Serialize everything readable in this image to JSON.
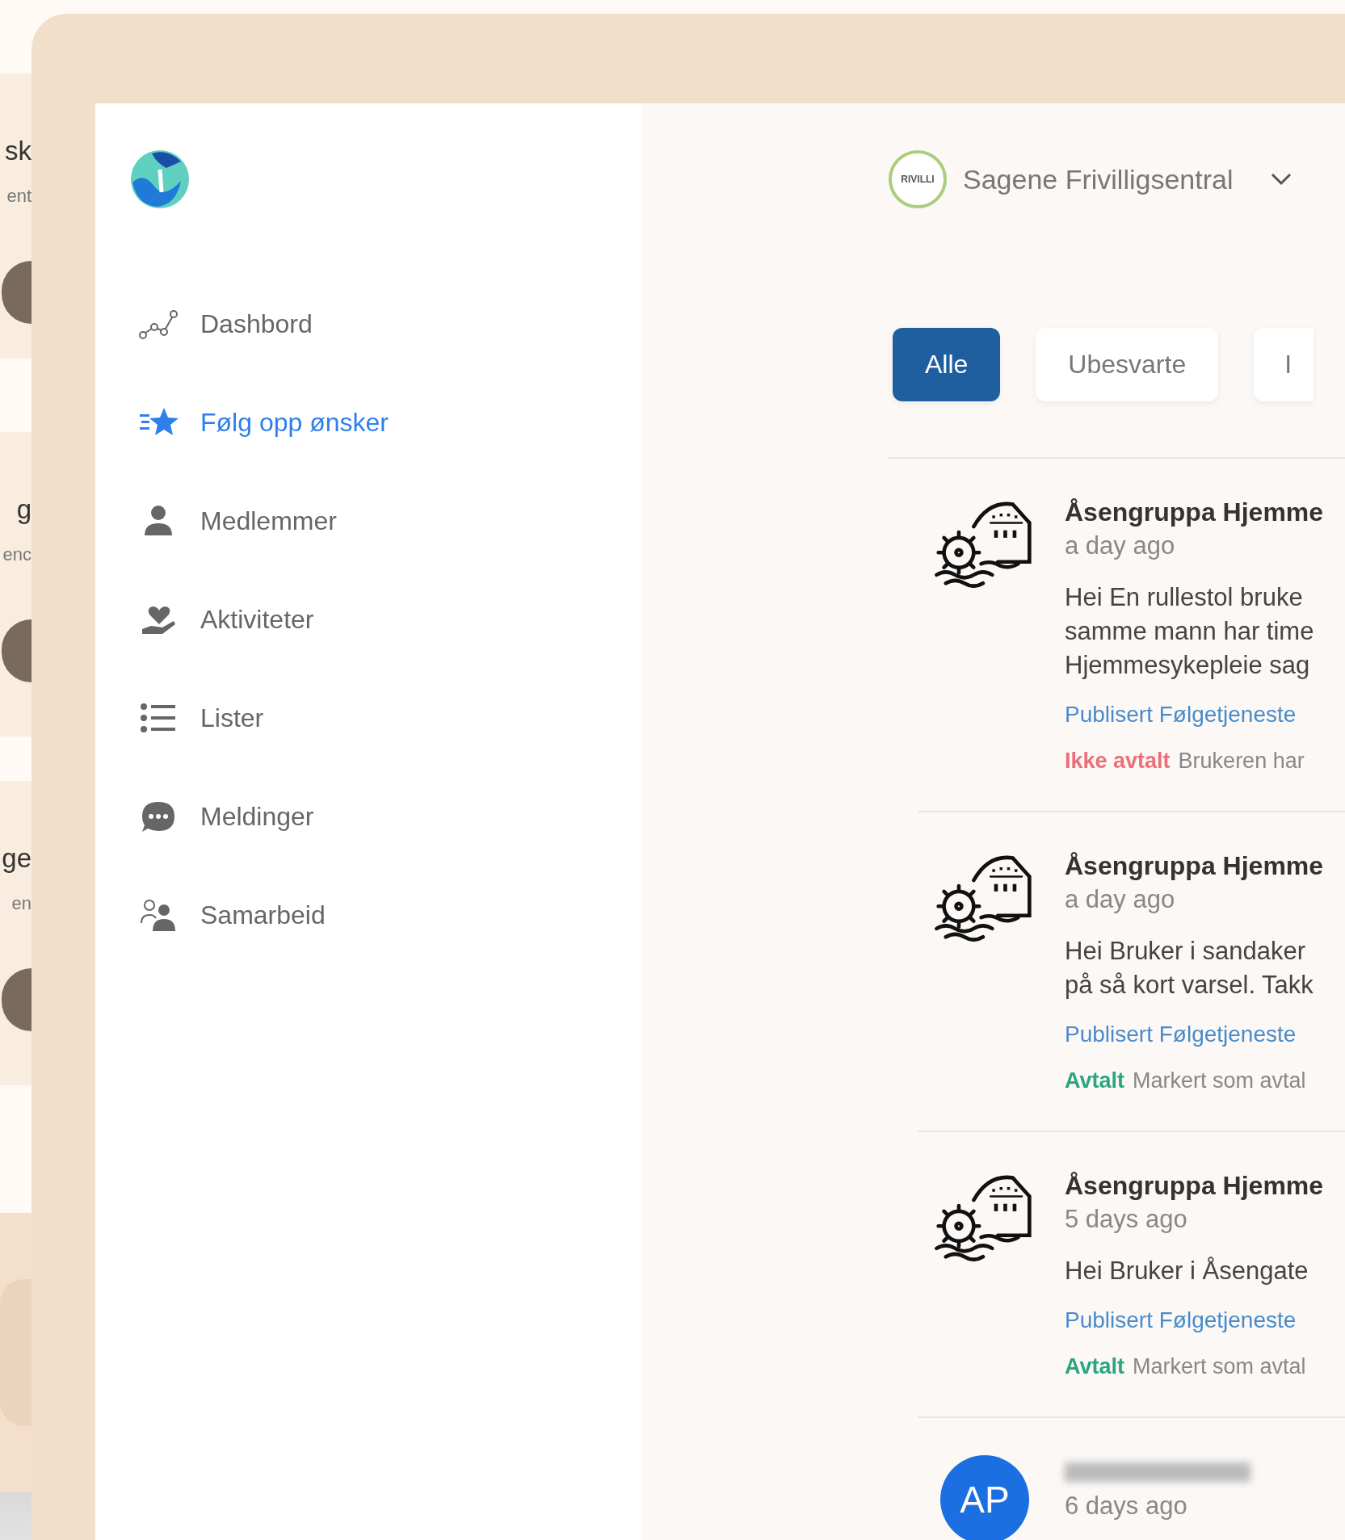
{
  "background_cards": [
    {
      "title": "sk",
      "subtitle": "ent"
    },
    {
      "title": "g",
      "subtitle": "enc"
    },
    {
      "title": "ge",
      "subtitle": "en"
    }
  ],
  "sidebar": {
    "items": [
      {
        "label": "Dashbord",
        "selected": false
      },
      {
        "label": "Følg opp ønsker",
        "selected": true
      },
      {
        "label": "Medlemmer",
        "selected": false
      },
      {
        "label": "Aktiviteter",
        "selected": false
      },
      {
        "label": "Lister",
        "selected": false
      },
      {
        "label": "Meldinger",
        "selected": false
      },
      {
        "label": "Samarbeid",
        "selected": false
      }
    ]
  },
  "organization": {
    "logo_text": "RIVILLI",
    "name": "Sagene Frivilligsentral"
  },
  "tabs": [
    {
      "label": "Alle",
      "selected": true
    },
    {
      "label": "Ubesvarte",
      "selected": false
    },
    {
      "label": "I",
      "selected": false
    }
  ],
  "messages": [
    {
      "kind": "organization",
      "sender": "Åsengruppa Hjemme",
      "time": "a day ago",
      "body_lines": [
        "Hei En rullestol bruke",
        "samme mann har time",
        "Hjemmesykepleie sag"
      ],
      "tag": "Publisert Følgetjeneste",
      "status": {
        "kind": "not_agreed",
        "label": "Ikke avtalt",
        "note": "Brukeren har"
      }
    },
    {
      "kind": "organization",
      "sender": "Åsengruppa Hjemme",
      "time": "a day ago",
      "body_lines": [
        "Hei Bruker i sandaker",
        "på så kort varsel. Takk"
      ],
      "tag": "Publisert Følgetjeneste",
      "status": {
        "kind": "agreed",
        "label": "Avtalt",
        "note": "Markert som avtal"
      }
    },
    {
      "kind": "organization",
      "sender": "Åsengruppa Hjemme",
      "time": "5 days ago",
      "body_lines": [
        "Hei Bruker i Åsengate"
      ],
      "tag": "Publisert Følgetjeneste",
      "status": {
        "kind": "agreed",
        "label": "Avtalt",
        "note": "Markert som avtal"
      }
    },
    {
      "kind": "person",
      "initials": "AP",
      "time": "6 days ago"
    }
  ]
}
